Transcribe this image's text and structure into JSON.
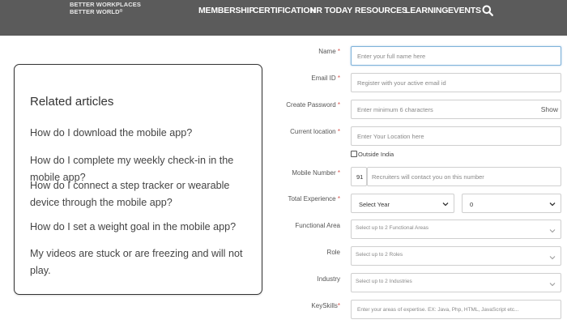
{
  "header": {
    "logo_line1": "BETTER WORKPLACES",
    "logo_line2": "BETTER WORLD",
    "logo_mark": "®",
    "nav": [
      "MEMBERSHIP",
      "CERTIFICATION",
      "HR TODAY",
      "RESOURCES",
      "LEARNING",
      "EVENTS"
    ],
    "search_icon": "search-icon"
  },
  "related": {
    "title": "Related articles",
    "links": [
      "How do I download the mobile app?",
      "How do I complete my weekly check-in in the mobile app?",
      "How do I connect a step tracker or wearable device through the mobile app?",
      "How do I set a weight goal in the mobile app?",
      "My videos are stuck or are freezing and will not play."
    ]
  },
  "form": {
    "name": {
      "label": "Name",
      "req": "*",
      "placeholder": "Enter your full name here"
    },
    "email": {
      "label": "Email ID",
      "req": "*",
      "placeholder": "Register with your active email id"
    },
    "password": {
      "label": "Create Password",
      "req": "*",
      "placeholder": "Enter minimum 6 characters",
      "show": "Show"
    },
    "location": {
      "label": "Current location",
      "req": "*",
      "placeholder": "Enter Your Location here"
    },
    "outside_india": "Outside India",
    "mobile": {
      "label": "Mobile Number",
      "req": "*",
      "code": "91",
      "placeholder": "Recruiters will contact you on this number"
    },
    "experience": {
      "label": "Total Experience",
      "req": "*",
      "year": "Select Year",
      "month": "0"
    },
    "functional": {
      "label": "Functional Area",
      "placeholder": "Select up to 2 Functional Areas"
    },
    "role": {
      "label": "Role",
      "placeholder": "Select up to 2 Roles"
    },
    "industry": {
      "label": "Industry",
      "placeholder": "Select up to 2 Industries"
    },
    "keyskills": {
      "label": "KeySkills",
      "req": "*",
      "placeholder": "Enter your areas of expertise. EX: Java, Php, HTML, JavaScript etc..."
    }
  }
}
